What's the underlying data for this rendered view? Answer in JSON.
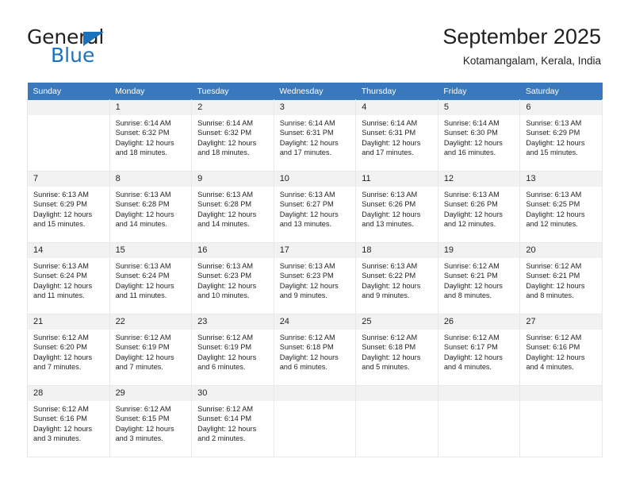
{
  "brand": {
    "line1": "General",
    "line2": "Blue",
    "accent_color": "#1b72ba"
  },
  "header": {
    "title": "September 2025",
    "subtitle": "Kotamangalam, Kerala, India"
  },
  "theme": {
    "header_row_bg": "#3a78bd",
    "daynum_bg": "#f2f2f2",
    "cell_border": "#e8e8e8"
  },
  "weekdays": [
    "Sunday",
    "Monday",
    "Tuesday",
    "Wednesday",
    "Thursday",
    "Friday",
    "Saturday"
  ],
  "weeks": [
    [
      {
        "day": "",
        "lines": []
      },
      {
        "day": "1",
        "lines": [
          "Sunrise: 6:14 AM",
          "Sunset: 6:32 PM",
          "Daylight: 12 hours",
          "and 18 minutes."
        ]
      },
      {
        "day": "2",
        "lines": [
          "Sunrise: 6:14 AM",
          "Sunset: 6:32 PM",
          "Daylight: 12 hours",
          "and 18 minutes."
        ]
      },
      {
        "day": "3",
        "lines": [
          "Sunrise: 6:14 AM",
          "Sunset: 6:31 PM",
          "Daylight: 12 hours",
          "and 17 minutes."
        ]
      },
      {
        "day": "4",
        "lines": [
          "Sunrise: 6:14 AM",
          "Sunset: 6:31 PM",
          "Daylight: 12 hours",
          "and 17 minutes."
        ]
      },
      {
        "day": "5",
        "lines": [
          "Sunrise: 6:14 AM",
          "Sunset: 6:30 PM",
          "Daylight: 12 hours",
          "and 16 minutes."
        ]
      },
      {
        "day": "6",
        "lines": [
          "Sunrise: 6:13 AM",
          "Sunset: 6:29 PM",
          "Daylight: 12 hours",
          "and 15 minutes."
        ]
      }
    ],
    [
      {
        "day": "7",
        "lines": [
          "Sunrise: 6:13 AM",
          "Sunset: 6:29 PM",
          "Daylight: 12 hours",
          "and 15 minutes."
        ]
      },
      {
        "day": "8",
        "lines": [
          "Sunrise: 6:13 AM",
          "Sunset: 6:28 PM",
          "Daylight: 12 hours",
          "and 14 minutes."
        ]
      },
      {
        "day": "9",
        "lines": [
          "Sunrise: 6:13 AM",
          "Sunset: 6:28 PM",
          "Daylight: 12 hours",
          "and 14 minutes."
        ]
      },
      {
        "day": "10",
        "lines": [
          "Sunrise: 6:13 AM",
          "Sunset: 6:27 PM",
          "Daylight: 12 hours",
          "and 13 minutes."
        ]
      },
      {
        "day": "11",
        "lines": [
          "Sunrise: 6:13 AM",
          "Sunset: 6:26 PM",
          "Daylight: 12 hours",
          "and 13 minutes."
        ]
      },
      {
        "day": "12",
        "lines": [
          "Sunrise: 6:13 AM",
          "Sunset: 6:26 PM",
          "Daylight: 12 hours",
          "and 12 minutes."
        ]
      },
      {
        "day": "13",
        "lines": [
          "Sunrise: 6:13 AM",
          "Sunset: 6:25 PM",
          "Daylight: 12 hours",
          "and 12 minutes."
        ]
      }
    ],
    [
      {
        "day": "14",
        "lines": [
          "Sunrise: 6:13 AM",
          "Sunset: 6:24 PM",
          "Daylight: 12 hours",
          "and 11 minutes."
        ]
      },
      {
        "day": "15",
        "lines": [
          "Sunrise: 6:13 AM",
          "Sunset: 6:24 PM",
          "Daylight: 12 hours",
          "and 11 minutes."
        ]
      },
      {
        "day": "16",
        "lines": [
          "Sunrise: 6:13 AM",
          "Sunset: 6:23 PM",
          "Daylight: 12 hours",
          "and 10 minutes."
        ]
      },
      {
        "day": "17",
        "lines": [
          "Sunrise: 6:13 AM",
          "Sunset: 6:23 PM",
          "Daylight: 12 hours",
          "and 9 minutes."
        ]
      },
      {
        "day": "18",
        "lines": [
          "Sunrise: 6:13 AM",
          "Sunset: 6:22 PM",
          "Daylight: 12 hours",
          "and 9 minutes."
        ]
      },
      {
        "day": "19",
        "lines": [
          "Sunrise: 6:12 AM",
          "Sunset: 6:21 PM",
          "Daylight: 12 hours",
          "and 8 minutes."
        ]
      },
      {
        "day": "20",
        "lines": [
          "Sunrise: 6:12 AM",
          "Sunset: 6:21 PM",
          "Daylight: 12 hours",
          "and 8 minutes."
        ]
      }
    ],
    [
      {
        "day": "21",
        "lines": [
          "Sunrise: 6:12 AM",
          "Sunset: 6:20 PM",
          "Daylight: 12 hours",
          "and 7 minutes."
        ]
      },
      {
        "day": "22",
        "lines": [
          "Sunrise: 6:12 AM",
          "Sunset: 6:19 PM",
          "Daylight: 12 hours",
          "and 7 minutes."
        ]
      },
      {
        "day": "23",
        "lines": [
          "Sunrise: 6:12 AM",
          "Sunset: 6:19 PM",
          "Daylight: 12 hours",
          "and 6 minutes."
        ]
      },
      {
        "day": "24",
        "lines": [
          "Sunrise: 6:12 AM",
          "Sunset: 6:18 PM",
          "Daylight: 12 hours",
          "and 6 minutes."
        ]
      },
      {
        "day": "25",
        "lines": [
          "Sunrise: 6:12 AM",
          "Sunset: 6:18 PM",
          "Daylight: 12 hours",
          "and 5 minutes."
        ]
      },
      {
        "day": "26",
        "lines": [
          "Sunrise: 6:12 AM",
          "Sunset: 6:17 PM",
          "Daylight: 12 hours",
          "and 4 minutes."
        ]
      },
      {
        "day": "27",
        "lines": [
          "Sunrise: 6:12 AM",
          "Sunset: 6:16 PM",
          "Daylight: 12 hours",
          "and 4 minutes."
        ]
      }
    ],
    [
      {
        "day": "28",
        "lines": [
          "Sunrise: 6:12 AM",
          "Sunset: 6:16 PM",
          "Daylight: 12 hours",
          "and 3 minutes."
        ]
      },
      {
        "day": "29",
        "lines": [
          "Sunrise: 6:12 AM",
          "Sunset: 6:15 PM",
          "Daylight: 12 hours",
          "and 3 minutes."
        ]
      },
      {
        "day": "30",
        "lines": [
          "Sunrise: 6:12 AM",
          "Sunset: 6:14 PM",
          "Daylight: 12 hours",
          "and 2 minutes."
        ]
      },
      {
        "day": "",
        "lines": []
      },
      {
        "day": "",
        "lines": []
      },
      {
        "day": "",
        "lines": []
      },
      {
        "day": "",
        "lines": []
      }
    ]
  ]
}
